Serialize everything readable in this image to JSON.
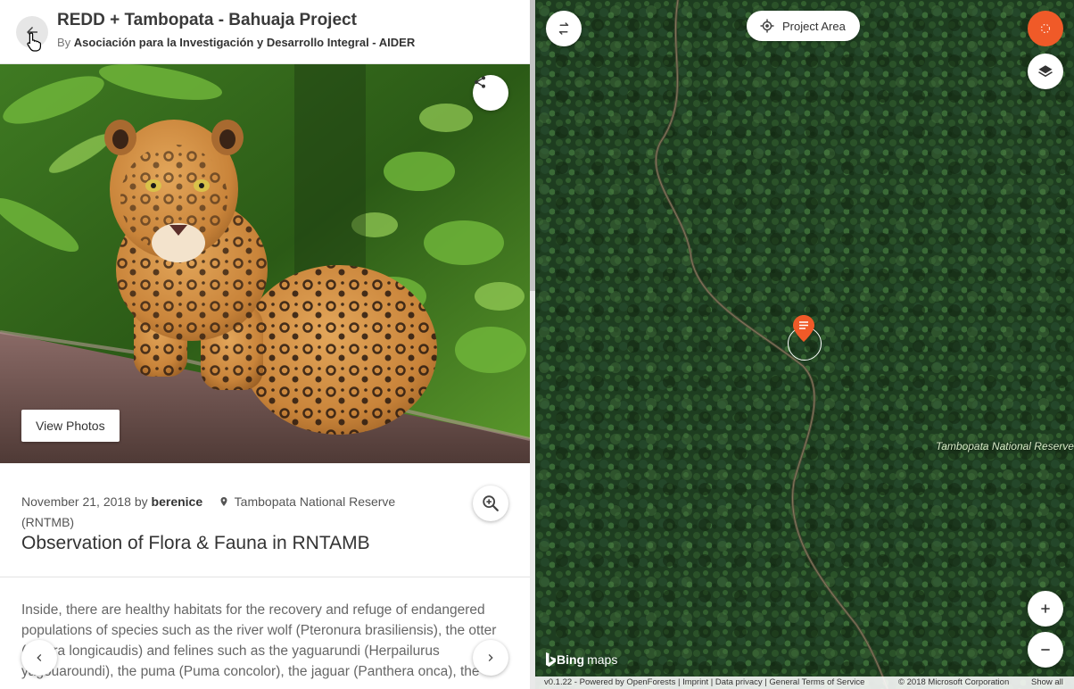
{
  "header": {
    "title": "REDD + Tambopata - Bahuaja Project",
    "by_prefix": "By",
    "organization": "Asociación para la Investigación y Desarrollo Integral - AIDER"
  },
  "photo": {
    "view_photos_label": "View Photos"
  },
  "observation": {
    "date": "November 21, 2018",
    "by_word": "by",
    "author": "berenice",
    "location": "Tambopata National Reserve",
    "location_code": "(RNTMB)",
    "title": "Observation of Flora & Fauna in RNTAMB",
    "description": "Inside, there are healthy habitats for the recovery and refuge of endangered populations of species such as the river wolf (Pteronura brasiliensis), the otter (Lontra longicaudis) and felines such as the yaguarundi (Herpailurus yagouaroundi), the puma (Puma concolor), the jaguar (Panthera onca), the"
  },
  "map": {
    "project_area_label": "Project Area",
    "region_label": "Tambopata National Reserve",
    "bing_logo": "Bing",
    "bing_suffix": "maps",
    "footer_left": "v0.1.22 - Powered by OpenForests | Imprint | Data privacy | General Terms of Service",
    "footer_copyright": "© 2018 Microsoft Corporation",
    "footer_show_all": "Show all"
  },
  "icons": {
    "back": "arrow-left-icon",
    "share": "share-icon",
    "zoom": "zoom-in-icon",
    "pin": "location-pin-icon",
    "swap": "swap-arrows-icon",
    "target": "crosshair-icon",
    "layers": "layers-icon",
    "plus": "plus-icon",
    "minus": "minus-icon",
    "prev": "chevron-left-icon",
    "next": "chevron-right-icon"
  },
  "colors": {
    "accent": "#f05a28",
    "text_primary": "#333333",
    "text_secondary": "#666666"
  }
}
